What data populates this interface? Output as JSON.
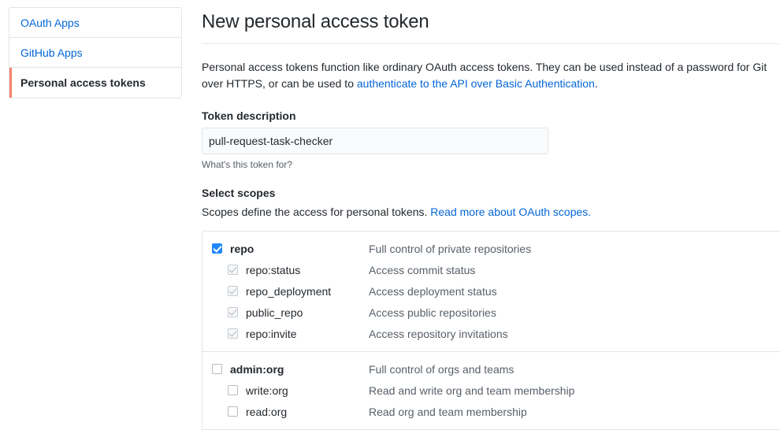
{
  "sidebar": {
    "items": [
      {
        "label": "OAuth Apps",
        "selected": false
      },
      {
        "label": "GitHub Apps",
        "selected": false
      },
      {
        "label": "Personal access tokens",
        "selected": true
      }
    ]
  },
  "main": {
    "title": "New personal access token",
    "intro": {
      "text_before": "Personal access tokens function like ordinary OAuth access tokens. They can be used instead of a password for Git over HTTPS, or can be used to ",
      "link_text": "authenticate to the API over Basic Authentication",
      "text_after": "."
    },
    "token_description": {
      "label": "Token description",
      "value": "pull-request-task-checker",
      "placeholder": "",
      "help": "What's this token for?"
    },
    "scopes": {
      "label": "Select scopes",
      "sub_text_before": "Scopes define the access for personal tokens. ",
      "sub_link_text": "Read more about OAuth scopes.",
      "groups": [
        {
          "rows": [
            {
              "name": "repo",
              "desc": "Full control of private repositories",
              "level": "parent",
              "state": "checked"
            },
            {
              "name": "repo:status",
              "desc": "Access commit status",
              "level": "child",
              "state": "disabled-checked"
            },
            {
              "name": "repo_deployment",
              "desc": "Access deployment status",
              "level": "child",
              "state": "disabled-checked"
            },
            {
              "name": "public_repo",
              "desc": "Access public repositories",
              "level": "child",
              "state": "disabled-checked"
            },
            {
              "name": "repo:invite",
              "desc": "Access repository invitations",
              "level": "child",
              "state": "disabled-checked"
            }
          ]
        },
        {
          "rows": [
            {
              "name": "admin:org",
              "desc": "Full control of orgs and teams",
              "level": "parent",
              "state": "unchecked"
            },
            {
              "name": "write:org",
              "desc": "Read and write org and team membership",
              "level": "child",
              "state": "unchecked"
            },
            {
              "name": "read:org",
              "desc": "Read org and team membership",
              "level": "child",
              "state": "unchecked"
            }
          ]
        }
      ]
    }
  },
  "colors": {
    "accent_blue": "#0366d6",
    "checkbox_blue": "#2188ff",
    "selected_bar_orange": "#f9826c",
    "border": "#e1e4e8",
    "muted_text": "#586069"
  }
}
